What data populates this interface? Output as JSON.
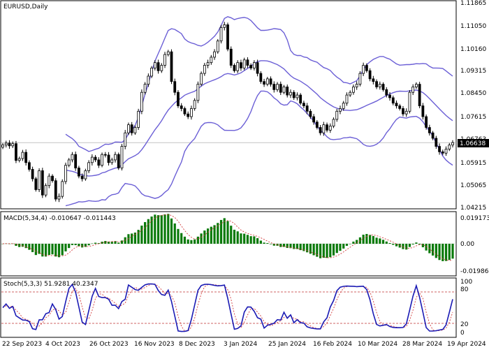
{
  "colors": {
    "background": "#ffffff",
    "candle": "#000000",
    "bands": "#6b5fd6",
    "histogram": "#0a7a0a",
    "signal": "#d23c3c",
    "stoch_main": "#1a1ab4",
    "stoch_signal": "#d23c3c",
    "level": "#c03030",
    "price_line": "#a0a0a0",
    "price_badge_bg": "#000000",
    "price_badge_fg": "#ffffff"
  },
  "main": {
    "title": "EURUSD,Daily",
    "price_label": "1.06638",
    "y_ticks": [
      "1.11865",
      "1.11050",
      "1.10160",
      "1.09315",
      "1.08450",
      "1.07615",
      "1.06763",
      "1.05915",
      "1.05065",
      "1.04215"
    ]
  },
  "macd": {
    "title": "MACD(5,34,4) -0.010647 -0.011443",
    "y_ticks": [
      "0.019173",
      "0.00",
      "-0.019861"
    ]
  },
  "stoch": {
    "title": "Stoch(5,3,3) 51.9281 40.2347",
    "y_ticks": [
      "100",
      "80",
      "20",
      "0"
    ]
  },
  "x_labels": [
    "22 Sep 2023",
    "4 Oct 2023",
    "26 Oct 2023",
    "16 Nov 2023",
    "8 Dec 2023",
    "3 Jan 2024",
    "25 Jan 2024",
    "16 Feb 2024",
    "10 Mar 2024",
    "28 Mar 2024",
    "19 Apr 2024"
  ],
  "chart_data": {
    "type": "candlestick",
    "symbol": "EURUSD",
    "timeframe": "Daily",
    "ylim": [
      1.04215,
      1.11865
    ],
    "close": [
      1.0655,
      1.0662,
      1.0652,
      1.066,
      1.0598,
      1.0605,
      1.0628,
      1.059,
      1.0565,
      1.053,
      1.049,
      1.056,
      1.047,
      1.0505,
      1.054,
      1.0523,
      1.0455,
      1.0465,
      1.052,
      1.058,
      1.06,
      1.062,
      1.057,
      1.054,
      1.053,
      1.056,
      1.059,
      1.061,
      1.06,
      1.058,
      1.062,
      1.0618,
      1.059,
      1.06,
      1.062,
      1.057,
      1.065,
      1.07,
      1.073,
      1.07,
      1.072,
      1.078,
      1.085,
      1.088,
      1.091,
      1.094,
      1.096,
      1.093,
      1.095,
      1.099,
      1.1,
      1.089,
      1.085,
      1.08,
      1.079,
      1.077,
      1.076,
      1.079,
      1.082,
      1.088,
      1.092,
      1.095,
      1.096,
      1.098,
      1.1,
      1.104,
      1.109,
      1.11,
      1.101,
      1.095,
      1.093,
      1.096,
      1.094,
      1.097,
      1.095,
      1.094,
      1.096,
      1.092,
      1.089,
      1.088,
      1.09,
      1.088,
      1.086,
      1.088,
      1.085,
      1.087,
      1.084,
      1.085,
      1.083,
      1.084,
      1.081,
      1.08,
      1.078,
      1.076,
      1.074,
      1.072,
      1.07,
      1.073,
      1.071,
      1.0725,
      1.075,
      1.078,
      1.079,
      1.081,
      1.084,
      1.085,
      1.087,
      1.088,
      1.092,
      1.095,
      1.093,
      1.09,
      1.089,
      1.087,
      1.088,
      1.086,
      1.084,
      1.083,
      1.081,
      1.08,
      1.079,
      1.077,
      1.078,
      1.085,
      1.087,
      1.088,
      1.08,
      1.076,
      1.072,
      1.07,
      1.068,
      1.065,
      1.063,
      1.0625,
      1.064,
      1.0655,
      1.0664
    ]
  }
}
